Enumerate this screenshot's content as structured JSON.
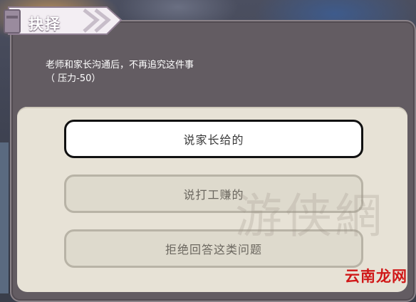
{
  "dialog": {
    "title": "抉择",
    "prompt_line1": "老师和家长沟通后，不再追究这件事",
    "prompt_line2": "（ 压力-50）"
  },
  "options": [
    {
      "label": "说家长给的",
      "state": "selected"
    },
    {
      "label": "说打工赚的",
      "state": "normal"
    },
    {
      "label": "拒绝回答这类问题",
      "state": "normal"
    }
  ],
  "watermarks": {
    "site": "云南龙网",
    "faint": "游侠網"
  },
  "colors": {
    "dialog_bg": "#635c62",
    "panel_bg": "#e7e2d6",
    "selected_border": "#111111",
    "watermark_red": "#d01818"
  }
}
